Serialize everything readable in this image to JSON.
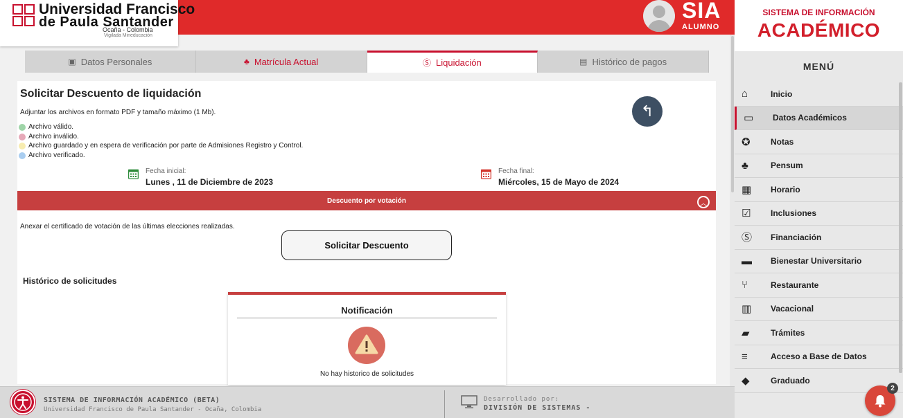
{
  "header": {
    "logo_line1": "Universidad Francisco",
    "logo_line2": "de Paula Santander",
    "logo_line3": "Ocaña - Colombia",
    "logo_line4": "Vigilada Mineducación",
    "sia_title": "SIA",
    "sia_subtitle": "ALUMNO"
  },
  "tabs": [
    {
      "label": "Datos Personales",
      "icon": "id-card-icon"
    },
    {
      "label": "Matrícula Actual",
      "icon": "org-chart-icon"
    },
    {
      "label": "Liquidación",
      "icon": "dollar-circle-icon",
      "active": true
    },
    {
      "label": "Histórico de pagos",
      "icon": "ledger-icon"
    }
  ],
  "page": {
    "title": "Solicitar Descuento de liquidación",
    "instructions": "Adjuntar los archivos en formato PDF y tamaño máximo (1 Mb).",
    "legend": [
      {
        "label": "Archivo válido.",
        "color": "#9fd5a8"
      },
      {
        "label": "Archivo inválido.",
        "color": "#e6a9b8"
      },
      {
        "label": "Archivo guardado y en espera de verificación por parte de Admisiones Registro y Control.",
        "color": "#f7ecb0"
      },
      {
        "label": "Archivo verificado.",
        "color": "#a9cdf0"
      }
    ],
    "start_date_label": "Fecha inicial:",
    "start_date_value": "Lunes , 11 de Diciembre de 2023",
    "end_date_label": "Fecha final:",
    "end_date_value": "Miércoles, 15 de Mayo de 2024",
    "section_title": "Descuento por votación",
    "annex_text": "Anexar el certificado de votación de las últimas elecciones realizadas.",
    "request_button": "Solicitar Descuento",
    "history_title": "Histórico de solicitudes",
    "notification_title": "Notificación",
    "notification_message": "No hay historico de solicitudes"
  },
  "footer": {
    "title": "SISTEMA DE INFORMACIÓN ACADÉMICO (BETA)",
    "subtitle": "Universidad Francisco de Paula Santander - Ocaña, Colombia",
    "dev_label": "Desarrollado por:",
    "dev_value": "DIVISIÓN DE SISTEMAS -"
  },
  "sidebar": {
    "system_label": "SISTEMA DE INFORMACIÓN",
    "app_name": "ACADÉMICO",
    "menu_title": "MENÚ",
    "items": [
      {
        "label": "Inicio",
        "icon": "home-icon"
      },
      {
        "label": "Datos Académicos",
        "icon": "credit-card-icon",
        "active": true
      },
      {
        "label": "Notas",
        "icon": "medal-icon"
      },
      {
        "label": "Pensum",
        "icon": "sitemap-icon"
      },
      {
        "label": "Horario",
        "icon": "calendar-icon"
      },
      {
        "label": "Inclusiones",
        "icon": "checkbox-icon"
      },
      {
        "label": "Financiación",
        "icon": "dollar-circle-icon"
      },
      {
        "label": "Bienestar Universitario",
        "icon": "briefcase-icon"
      },
      {
        "label": "Restaurante",
        "icon": "utensils-icon"
      },
      {
        "label": "Vacacional",
        "icon": "books-icon"
      },
      {
        "label": "Trámites",
        "icon": "folder-icon"
      },
      {
        "label": "Acceso a Base de Datos",
        "icon": "database-icon"
      },
      {
        "label": "Graduado",
        "icon": "graduation-cap-icon"
      }
    ]
  },
  "notifications": {
    "badge_count": "2"
  },
  "colors": {
    "brand_red": "#e02a2a",
    "section_red": "#c63f3f",
    "back_button": "#3d4f63"
  }
}
